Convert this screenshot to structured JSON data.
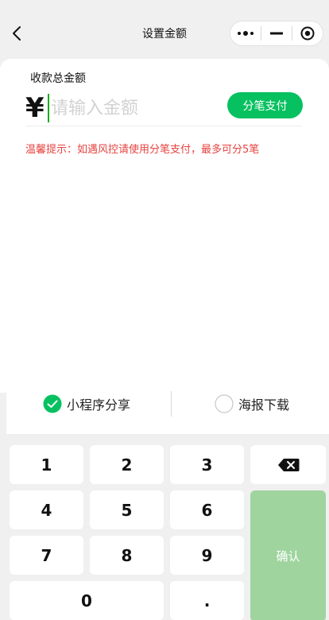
{
  "navbar": {
    "title": "设置金额",
    "back_icon": "chevron-left-icon",
    "capsule": {
      "more_icon": "more-dots-icon",
      "minimize_icon": "minimize-icon",
      "close_icon": "target-icon"
    }
  },
  "amount": {
    "label": "收款总金额",
    "currency": "¥",
    "placeholder": "请输入金额",
    "value": "",
    "split_button": "分笔支付",
    "tip": "温馨提示：如遇风控请使用分笔支付，最多可分5笔"
  },
  "share": {
    "options": [
      {
        "label": "小程序分享",
        "checked": true
      },
      {
        "label": "海报下载",
        "checked": false
      }
    ]
  },
  "keypad": {
    "keys": [
      "1",
      "2",
      "3",
      "4",
      "5",
      "6",
      "7",
      "8",
      "9",
      "0",
      "."
    ],
    "backspace_icon": "backspace-icon",
    "confirm": "确认"
  },
  "colors": {
    "accent": "#07c160",
    "confirm_disabled": "#9fd49e",
    "tip": "#e64340",
    "background": "#f0f0f0"
  }
}
